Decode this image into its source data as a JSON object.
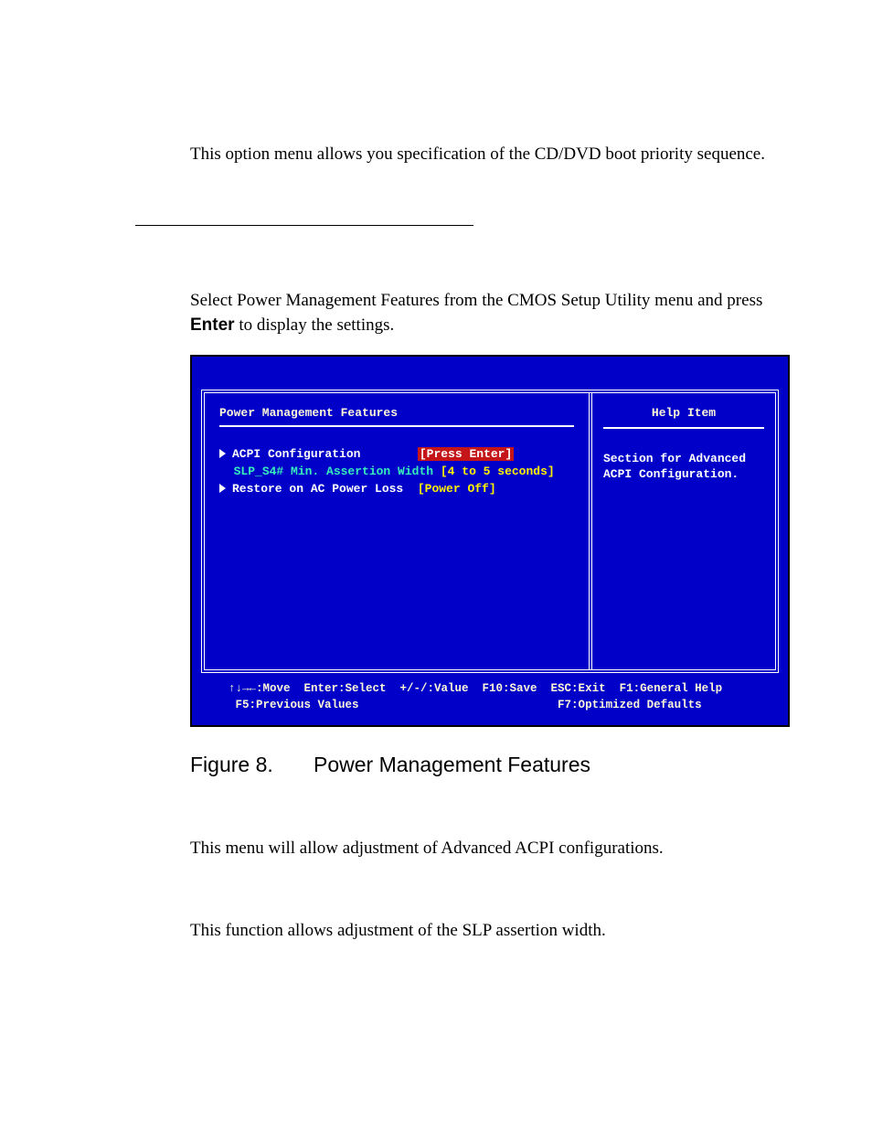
{
  "para1": "This option menu allows you specification of the CD/DVD boot priority sequence.",
  "para2_pre": "Select Power Management Features from the CMOS Setup Utility menu and press ",
  "para2_bold": "Enter",
  "para2_post": " to display the settings.",
  "bios": {
    "title": "Power Management Features",
    "help_title": "Help Item",
    "help_text": "Section for Advanced ACPI Configuration.",
    "rows": [
      {
        "tri": true,
        "label": "ACPI Configuration",
        "label_class": "label",
        "spacer": "        ",
        "val": "[Press Enter]",
        "val_class": "val-highlight"
      },
      {
        "tri": false,
        "label": "SLP_S4# Min. Assertion Width ",
        "label_class": "label-green",
        "spacer": "",
        "val": "[4 to 5 seconds]",
        "val_class": "val-yellow"
      },
      {
        "tri": true,
        "label": "Restore on AC Power Loss",
        "label_class": "label",
        "spacer": "  ",
        "val": "[Power Off]",
        "val_class": "val-yellow"
      }
    ],
    "footer_line1": "↑↓→←:Move  Enter:Select  +/-/:Value  F10:Save  ESC:Exit  F1:General Help",
    "footer_line2": " F5:Previous Values                             F7:Optimized Defaults"
  },
  "figure": {
    "num": "Figure 8.",
    "title": "Power Management Features"
  },
  "para3": "This menu will allow adjustment of Advanced ACPI configurations.",
  "para4": "This function allows adjustment of the SLP assertion width."
}
